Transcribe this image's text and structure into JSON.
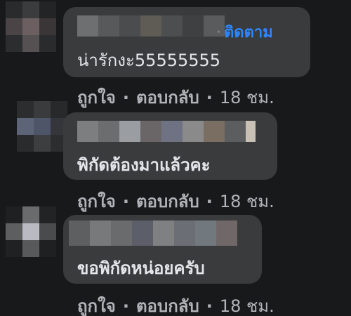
{
  "comments": [
    {
      "follow_label": "ติดตาม",
      "text": "น่ารักงะ55555555",
      "like_label": "ถูกใจ",
      "reply_label": "ตอบกลับ",
      "time": "18 ชม."
    },
    {
      "text": "พิกัดต้องมาแล้วคะ",
      "like_label": "ถูกใจ",
      "reply_label": "ตอบกลับ",
      "time": "18 ชม."
    },
    {
      "text": "ขอพิกัดหน่อยครับ",
      "like_label": "ถูกใจ",
      "reply_label": "ตอบกลับ",
      "time": "18 ชม."
    }
  ],
  "separator": "·",
  "colors": {
    "background": "#18191a",
    "bubble": "#3a3b3c",
    "follow": "#2d88ff",
    "text": "#e4e6eb",
    "meta": "#b0b3b8"
  }
}
